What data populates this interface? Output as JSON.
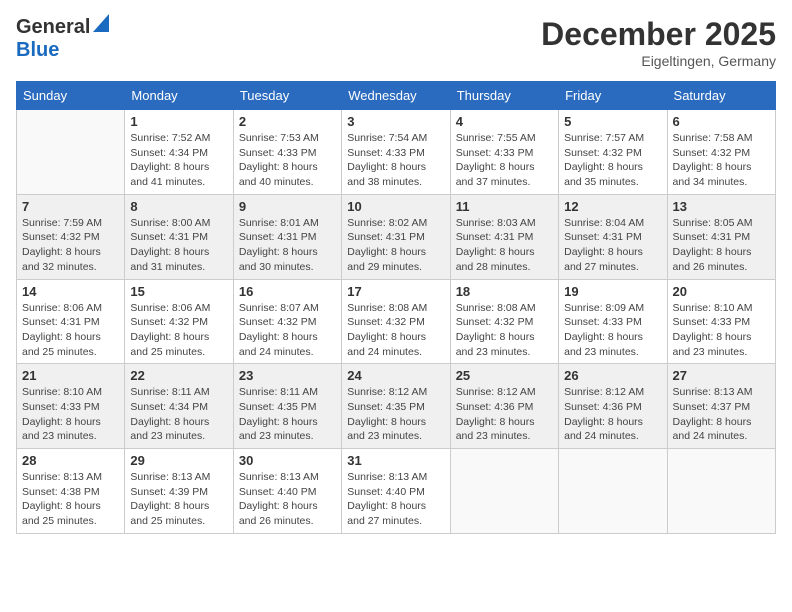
{
  "header": {
    "logo_general": "General",
    "logo_blue": "Blue",
    "month_title": "December 2025",
    "subtitle": "Eigeltingen, Germany"
  },
  "weekdays": [
    "Sunday",
    "Monday",
    "Tuesday",
    "Wednesday",
    "Thursday",
    "Friday",
    "Saturday"
  ],
  "weeks": [
    [
      {
        "day": "",
        "info": ""
      },
      {
        "day": "1",
        "info": "Sunrise: 7:52 AM\nSunset: 4:34 PM\nDaylight: 8 hours\nand 41 minutes."
      },
      {
        "day": "2",
        "info": "Sunrise: 7:53 AM\nSunset: 4:33 PM\nDaylight: 8 hours\nand 40 minutes."
      },
      {
        "day": "3",
        "info": "Sunrise: 7:54 AM\nSunset: 4:33 PM\nDaylight: 8 hours\nand 38 minutes."
      },
      {
        "day": "4",
        "info": "Sunrise: 7:55 AM\nSunset: 4:33 PM\nDaylight: 8 hours\nand 37 minutes."
      },
      {
        "day": "5",
        "info": "Sunrise: 7:57 AM\nSunset: 4:32 PM\nDaylight: 8 hours\nand 35 minutes."
      },
      {
        "day": "6",
        "info": "Sunrise: 7:58 AM\nSunset: 4:32 PM\nDaylight: 8 hours\nand 34 minutes."
      }
    ],
    [
      {
        "day": "7",
        "info": "Sunrise: 7:59 AM\nSunset: 4:32 PM\nDaylight: 8 hours\nand 32 minutes."
      },
      {
        "day": "8",
        "info": "Sunrise: 8:00 AM\nSunset: 4:31 PM\nDaylight: 8 hours\nand 31 minutes."
      },
      {
        "day": "9",
        "info": "Sunrise: 8:01 AM\nSunset: 4:31 PM\nDaylight: 8 hours\nand 30 minutes."
      },
      {
        "day": "10",
        "info": "Sunrise: 8:02 AM\nSunset: 4:31 PM\nDaylight: 8 hours\nand 29 minutes."
      },
      {
        "day": "11",
        "info": "Sunrise: 8:03 AM\nSunset: 4:31 PM\nDaylight: 8 hours\nand 28 minutes."
      },
      {
        "day": "12",
        "info": "Sunrise: 8:04 AM\nSunset: 4:31 PM\nDaylight: 8 hours\nand 27 minutes."
      },
      {
        "day": "13",
        "info": "Sunrise: 8:05 AM\nSunset: 4:31 PM\nDaylight: 8 hours\nand 26 minutes."
      }
    ],
    [
      {
        "day": "14",
        "info": "Sunrise: 8:06 AM\nSunset: 4:31 PM\nDaylight: 8 hours\nand 25 minutes."
      },
      {
        "day": "15",
        "info": "Sunrise: 8:06 AM\nSunset: 4:32 PM\nDaylight: 8 hours\nand 25 minutes."
      },
      {
        "day": "16",
        "info": "Sunrise: 8:07 AM\nSunset: 4:32 PM\nDaylight: 8 hours\nand 24 minutes."
      },
      {
        "day": "17",
        "info": "Sunrise: 8:08 AM\nSunset: 4:32 PM\nDaylight: 8 hours\nand 24 minutes."
      },
      {
        "day": "18",
        "info": "Sunrise: 8:08 AM\nSunset: 4:32 PM\nDaylight: 8 hours\nand 23 minutes."
      },
      {
        "day": "19",
        "info": "Sunrise: 8:09 AM\nSunset: 4:33 PM\nDaylight: 8 hours\nand 23 minutes."
      },
      {
        "day": "20",
        "info": "Sunrise: 8:10 AM\nSunset: 4:33 PM\nDaylight: 8 hours\nand 23 minutes."
      }
    ],
    [
      {
        "day": "21",
        "info": "Sunrise: 8:10 AM\nSunset: 4:33 PM\nDaylight: 8 hours\nand 23 minutes."
      },
      {
        "day": "22",
        "info": "Sunrise: 8:11 AM\nSunset: 4:34 PM\nDaylight: 8 hours\nand 23 minutes."
      },
      {
        "day": "23",
        "info": "Sunrise: 8:11 AM\nSunset: 4:35 PM\nDaylight: 8 hours\nand 23 minutes."
      },
      {
        "day": "24",
        "info": "Sunrise: 8:12 AM\nSunset: 4:35 PM\nDaylight: 8 hours\nand 23 minutes."
      },
      {
        "day": "25",
        "info": "Sunrise: 8:12 AM\nSunset: 4:36 PM\nDaylight: 8 hours\nand 23 minutes."
      },
      {
        "day": "26",
        "info": "Sunrise: 8:12 AM\nSunset: 4:36 PM\nDaylight: 8 hours\nand 24 minutes."
      },
      {
        "day": "27",
        "info": "Sunrise: 8:13 AM\nSunset: 4:37 PM\nDaylight: 8 hours\nand 24 minutes."
      }
    ],
    [
      {
        "day": "28",
        "info": "Sunrise: 8:13 AM\nSunset: 4:38 PM\nDaylight: 8 hours\nand 25 minutes."
      },
      {
        "day": "29",
        "info": "Sunrise: 8:13 AM\nSunset: 4:39 PM\nDaylight: 8 hours\nand 25 minutes."
      },
      {
        "day": "30",
        "info": "Sunrise: 8:13 AM\nSunset: 4:40 PM\nDaylight: 8 hours\nand 26 minutes."
      },
      {
        "day": "31",
        "info": "Sunrise: 8:13 AM\nSunset: 4:40 PM\nDaylight: 8 hours\nand 27 minutes."
      },
      {
        "day": "",
        "info": ""
      },
      {
        "day": "",
        "info": ""
      },
      {
        "day": "",
        "info": ""
      }
    ]
  ]
}
